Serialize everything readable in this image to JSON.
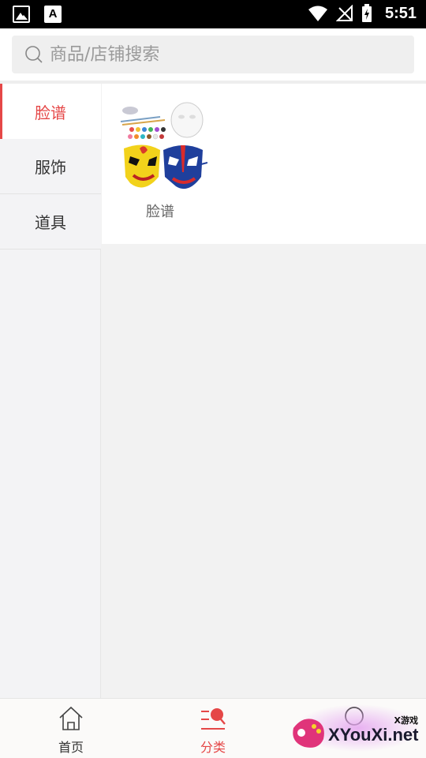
{
  "status_bar": {
    "time": "5:51",
    "left_icons": [
      "image-icon",
      "font-icon"
    ],
    "font_icon_letter": "A",
    "right_icons": [
      "wifi-icon",
      "no-signal-icon",
      "battery-charging-icon"
    ]
  },
  "search": {
    "placeholder": "商品/店铺搜索",
    "value": ""
  },
  "sidebar": {
    "items": [
      {
        "label": "脸谱",
        "active": true
      },
      {
        "label": "服饰",
        "active": false
      },
      {
        "label": "道具",
        "active": false
      }
    ]
  },
  "content": {
    "products": [
      {
        "name": "脸谱"
      }
    ]
  },
  "bottom_nav": {
    "items": [
      {
        "label": "首页",
        "icon": "home-icon",
        "active": false
      },
      {
        "label": "分类",
        "icon": "category-icon",
        "active": true
      },
      {
        "label": "",
        "icon": "search-icon",
        "active": false
      }
    ]
  },
  "watermark": {
    "text": "XYouXi.net",
    "small": "X游戏"
  },
  "colors": {
    "accent": "#e54747",
    "sidebar_bg": "#f3f3f5",
    "content_bg": "#f2f2f2"
  }
}
